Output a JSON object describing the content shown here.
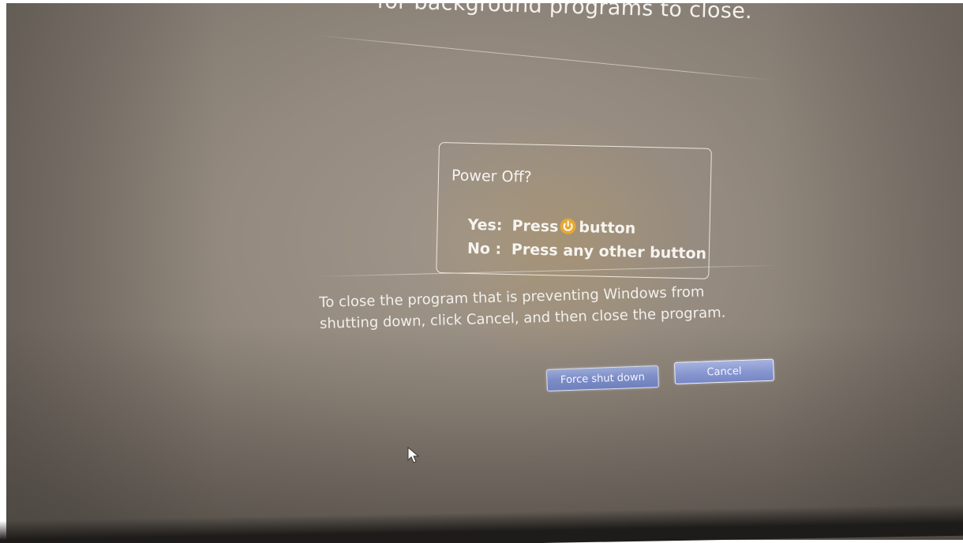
{
  "background_header": {
    "text": "for background programs to close."
  },
  "osd": {
    "title": "Power Off?",
    "yes_key": "Yes:",
    "yes_press": "Press",
    "yes_button_word": "button",
    "no_key": "No :",
    "no_text": "Press any other button",
    "icon": "power-icon",
    "icon_color": "#e6a934"
  },
  "message": {
    "text": "To close the program that is preventing Windows from shutting down, click Cancel, and then close the program."
  },
  "buttons": {
    "force_label": "Force shut down",
    "cancel_label": "Cancel"
  },
  "cursor": {
    "icon": "mouse-pointer-icon"
  }
}
